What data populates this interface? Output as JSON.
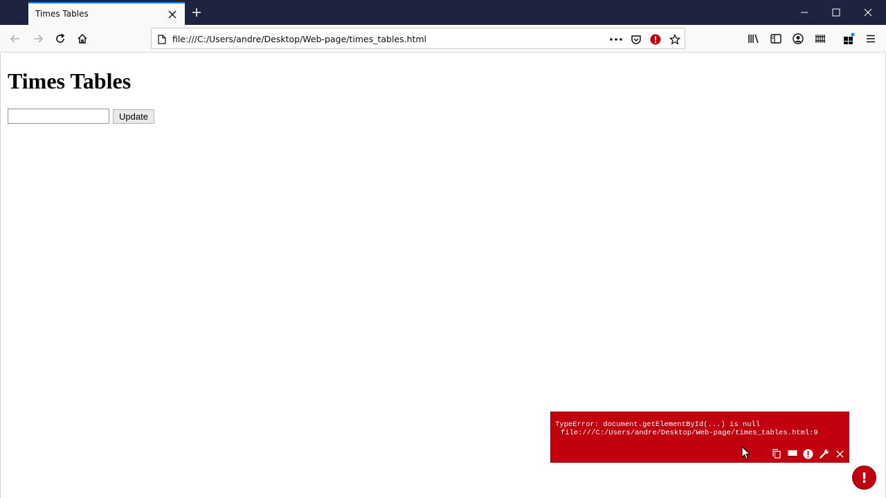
{
  "browser": {
    "tab_title": "Times Tables",
    "url": "file:///C:/Users/andre/Desktop/Web-page/times_tables.html"
  },
  "page": {
    "heading": "Times Tables",
    "number_input_value": "",
    "update_label": "Update"
  },
  "error_overlay": {
    "message": "TypeError: document.getElementById(...) is null",
    "location": "file:///C:/Users/andre/Desktop/Web-page/times_tables.html:9",
    "badge": "!"
  },
  "colors": {
    "titlebar": "#202340",
    "tab_accent": "#0a84ff",
    "toolbar": "#f9f9fa",
    "error_red": "#c0000f"
  },
  "icons": {
    "tab": [
      "close-icon",
      "plus-icon"
    ],
    "window": [
      "minimize-icon",
      "maximize-icon",
      "close-icon"
    ],
    "nav": [
      "back-arrow-icon",
      "forward-arrow-icon",
      "reload-icon",
      "home-icon"
    ],
    "urlbar": [
      "page-icon",
      "more-dots-icon",
      "pocket-icon",
      "blocked-icon",
      "star-icon"
    ],
    "toolbar_right": [
      "library-icon",
      "sidebar-icon",
      "account-icon",
      "extension-grid-icon",
      "addons-icon",
      "hamburger-menu-icon"
    ],
    "error_tools": [
      "copy-icon",
      "window-icon",
      "alert-icon",
      "wrench-icon",
      "close-icon"
    ]
  }
}
